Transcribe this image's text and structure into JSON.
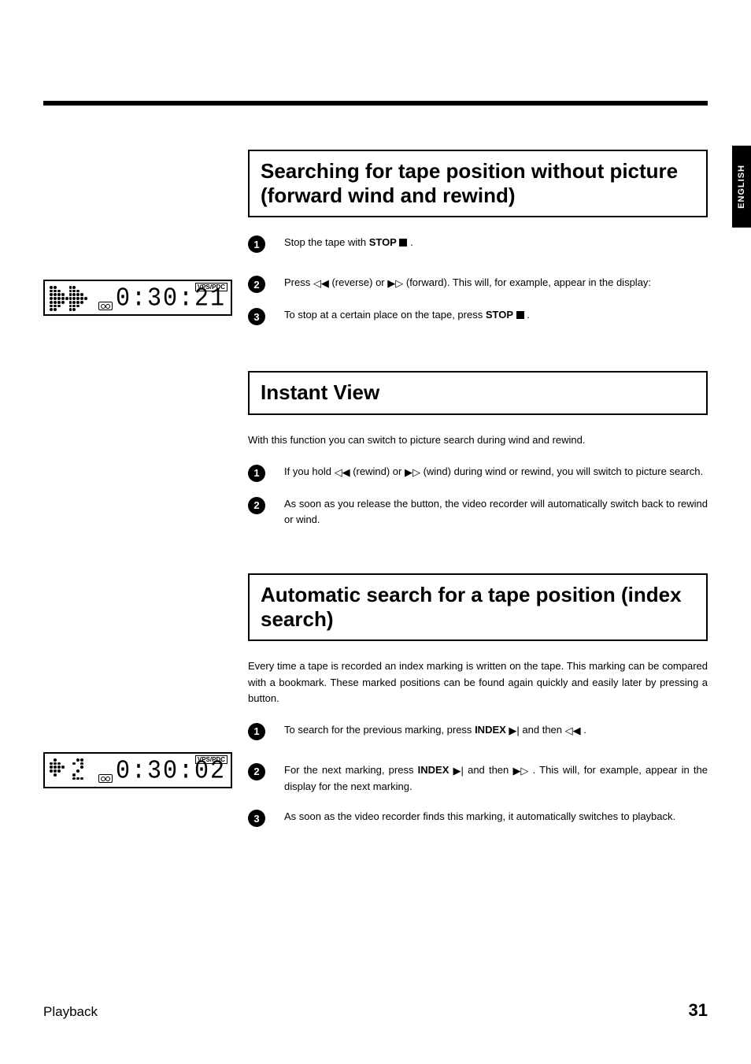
{
  "language_tab": "ENGLISH",
  "footer": {
    "section": "Playback",
    "page": "31"
  },
  "display": {
    "vps_label": "VPS/PDC",
    "time1": "0:30:21",
    "time2": "0:30:02"
  },
  "sections": {
    "s1": {
      "title": "Searching for tape position without picture (forward wind and rewind)",
      "steps": {
        "1a": "Stop the tape with ",
        "1b": "STOP",
        "1c": " .",
        "2a": "Press ",
        "2b": " (reverse) or ",
        "2c": " (forward). This will, for example, appear in the display:",
        "3a": "To stop at a certain place on the tape, press ",
        "3b": "STOP",
        "3c": " ."
      }
    },
    "s2": {
      "title": "Instant View",
      "intro": "With this function you can switch to picture search during wind and rewind.",
      "steps": {
        "1a": "If you hold ",
        "1b": " (rewind) or ",
        "1c": " (wind) during wind or rewind, you will switch to picture search.",
        "2": "As soon as you release the button, the video recorder will automatically switch back to rewind or wind."
      }
    },
    "s3": {
      "title": "Automatic search for a tape position (index search)",
      "intro": "Every time a tape is recorded an index marking is written on the tape. This marking can be compared with a bookmark. These marked positions can be found again quickly and easily later by pressing a button.",
      "steps": {
        "1a": "To search for the previous marking, press ",
        "1b": "INDEX",
        "1c": " and then ",
        "1d": " .",
        "2a": "For the next marking, press ",
        "2b": "INDEX",
        "2c": " and then ",
        "2d": " . This will, for example, appear in the display for the next marking.",
        "3": "As soon as the video recorder finds this marking, it automatically switches to playback."
      }
    }
  }
}
